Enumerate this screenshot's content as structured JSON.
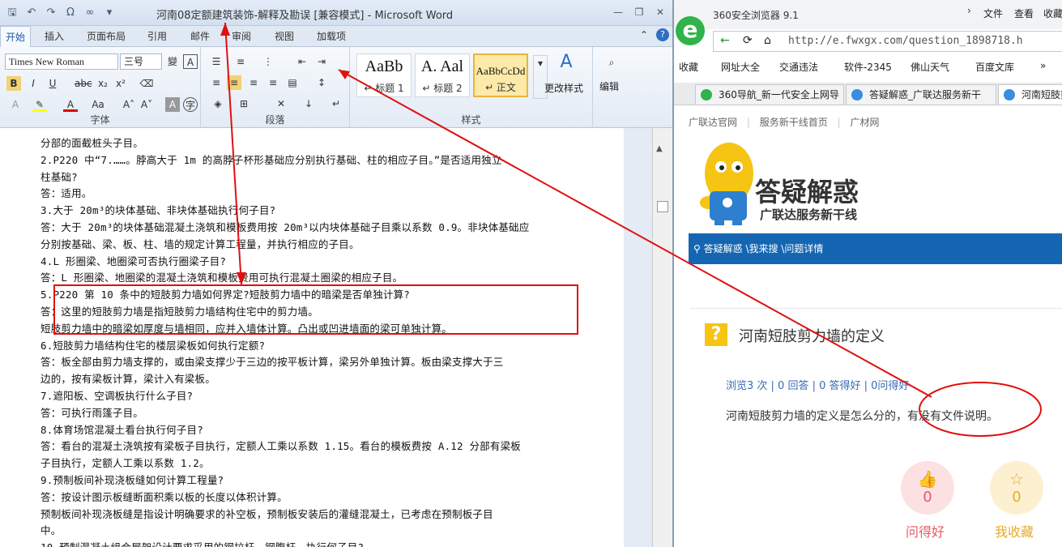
{
  "word": {
    "title": "河南08定额建筑装饰-解释及勘误 [兼容模式] - Microsoft Word",
    "qat": [
      "floppy-icon",
      "undo-icon",
      "redo-icon",
      "omega-icon",
      "infinity-icon"
    ],
    "tabs": [
      "开始",
      "插入",
      "页面布局",
      "引用",
      "邮件",
      "审阅",
      "视图",
      "加载项"
    ],
    "font_name": "Times New Roman",
    "font_size": "三号",
    "group_font": "字体",
    "group_paragraph": "段落",
    "group_style": "样式",
    "styles": [
      {
        "big": "AaBb",
        "sm": "↵ 标题 1"
      },
      {
        "big": "A. Aal",
        "sm": "↵ 标题 2"
      },
      {
        "big": "AaBbCcDd",
        "sm": "↵ 正文"
      }
    ],
    "change_styles": "更改样式",
    "edit": "编辑",
    "doc_lines": [
      "分部的面截桩头子目。",
      "    2.P220 中“7.……。脖高大于 1m 的高脖子杯形基础应分别执行基础、柱的相应子目。”是否适用独立",
      "柱基础?",
      "    答：适用。",
      "    3.大于 20m³的块体基础、非块体基础执行何子目?",
      "    答：大于 20m³的块体基础混凝土浇筑和模板费用按 20m³以内块体基础子目乘以系数 0.9。非块体基础应",
      "分别按基础、梁、板、柱、墙的规定计算工程量，并执行相应的子目。",
      "    4.L 形圈梁、地圈梁可否执行圈梁子目?",
      "    答：L 形圈梁、地圈梁的混凝土浇筑和模板费用可执行混凝土圈梁的相应子目。",
      "    5.P220 第 10 条中的短肢剪力墙如何界定?短肢剪力墙中的暗梁是否单独计算?",
      "    答：这里的短肢剪力墙是指短肢剪力墙结构住宅中的剪力墙。",
      "    短肢剪力墙中的暗梁如厚度与墙相同，应并入墙体计算。凸出或凹进墙面的梁可单独计算。",
      "    6.短肢剪力墙结构住宅的楼层梁板如何执行定额?",
      "    答：板全部由剪力墙支撑的，或由梁支撑少于三边的按平板计算，梁另外单独计算。板由梁支撑大于三",
      "边的，按有梁板计算，梁计入有梁板。",
      "    7.遮阳板、空调板执行什么子目?",
      "    答：可执行雨篷子目。",
      "    8.体育场馆混凝土看台执行何子目?",
      "    答：看台的混凝土浇筑按有梁板子目执行，定额人工乘以系数 1.15。看台的模板费按 A.12 分部有梁板",
      "子目执行，定额人工乘以系数 1.2。",
      "    9.预制板间补现浇板缝如何计算工程量?",
      "    答：按设计图示板缝断面积乘以板的长度以体积计算。",
      "    预制板间补现浇板缝是指设计明确要求的补空板，预制板安装后的灌缝混凝土，已考虑在预制板子目",
      "中。",
      "    10.预制混凝土组合屋架设计要求采用的钢拉杆、钢腹杆，执行何子目?"
    ]
  },
  "browser": {
    "title": "360安全浏览器 9.1",
    "menu": [
      "文件",
      "查看",
      "收藏"
    ],
    "url": "http://e.fwxgx.com/question_1898718.h",
    "favorites": [
      "收藏",
      "网址大全",
      "交通违法",
      "软件-2345",
      "佛山天气",
      "百度文库"
    ],
    "tabs": [
      "360导航_新一代安全上网导",
      "答疑解惑_广联达服务新干",
      "河南短肢剪"
    ],
    "nav": [
      "广联达官网",
      "服务新干线首页",
      "广材网"
    ],
    "brand": "答疑解惑",
    "slogan": "广联达服务新干线",
    "breadcrumb": "答疑解惑 \\我来搜 \\问题详情",
    "question_title": "河南短肢剪力墙的定义",
    "stats": "浏览3 次 | 0 回答 | 0 答得好 | 0问得好",
    "question_body": "河南短肢剪力墙的定义是怎么分的，有没有文件说明。",
    "good_count": "0",
    "good_label": "问得好",
    "fav_count": "0",
    "fav_label": "我收藏"
  }
}
